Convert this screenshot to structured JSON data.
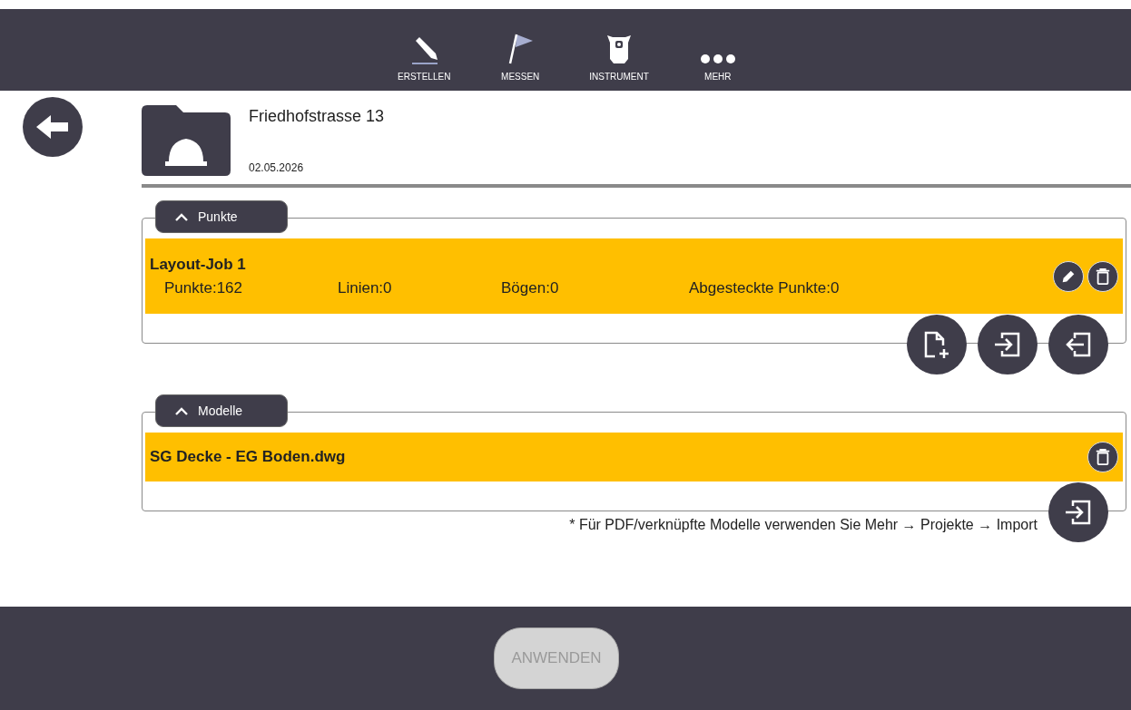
{
  "nav": [
    {
      "kind": "create",
      "label": "ERSTELLEN"
    },
    {
      "kind": "measure",
      "label": "MESSEN"
    },
    {
      "kind": "instrument",
      "label": "INSTRUMENT"
    },
    {
      "kind": "more",
      "label": "MEHR"
    }
  ],
  "project": {
    "title": "Friedhofstrasse 13",
    "date": "02.05.2026"
  },
  "sections": [
    {
      "title": "Punkte",
      "expanded": true,
      "rows": [
        {
          "name": "Layout-Job 1",
          "stats": [
            "Punkte:162",
            "Linien:0",
            "Bögen:0",
            "Abgesteckte Punkte:0"
          ],
          "actions": [
            {
              "kind": "edit"
            },
            {
              "kind": "delete"
            }
          ]
        }
      ],
      "actions": [
        {
          "kind": "new"
        },
        {
          "kind": "import"
        },
        {
          "kind": "export"
        }
      ]
    },
    {
      "title": "Modelle",
      "expanded": true,
      "rows": [
        {
          "name": "SG Decke - EG Boden.dwg",
          "actions": [
            {
              "kind": "delete"
            }
          ]
        }
      ],
      "actions": [
        {
          "kind": "import"
        }
      ],
      "note": "* Für PDF/verknüpfte Modelle verwenden Sie Mehr → Projekte → Import"
    }
  ],
  "apply": {
    "label": "ANWENDEN",
    "disabled": true
  }
}
